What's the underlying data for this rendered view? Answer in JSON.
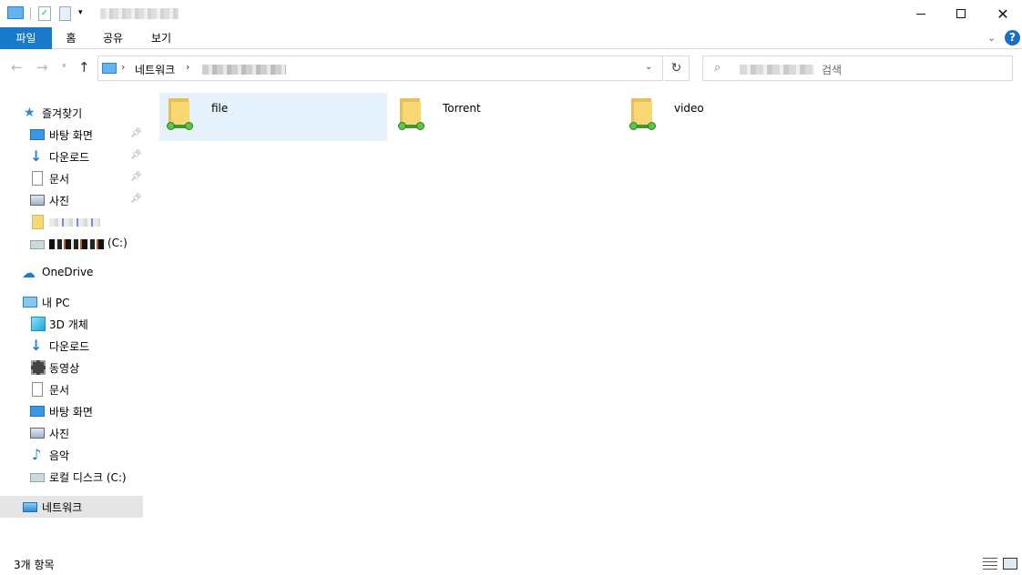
{
  "ribbon": {
    "tabs": [
      "파일",
      "홈",
      "공유",
      "보기"
    ],
    "help": "?"
  },
  "window_controls": {
    "close": "✕"
  },
  "nav": {
    "back": "←",
    "forward": "→",
    "recent": "▾",
    "up": "↑",
    "refresh": "↻",
    "dropdown": "⌄"
  },
  "address": {
    "separator": "›",
    "segments": [
      "네트워크"
    ]
  },
  "search": {
    "placeholder": "검색",
    "icon": "⌕"
  },
  "sidebar": {
    "quick_access": {
      "label": "즐겨찾기",
      "items": [
        {
          "label": "바탕 화면",
          "icon": "desktop-icon",
          "pinned": true
        },
        {
          "label": "다운로드",
          "icon": "download-icon",
          "pinned": true
        },
        {
          "label": "문서",
          "icon": "document-icon",
          "pinned": true
        },
        {
          "label": "사진",
          "icon": "pictures-icon",
          "pinned": true
        },
        {
          "label": "",
          "icon": "folder-icon",
          "pinned": false
        },
        {
          "label": "(C:)",
          "icon": "drive-icon",
          "pinned": false
        }
      ]
    },
    "onedrive": {
      "label": "OneDrive"
    },
    "this_pc": {
      "label": "내 PC",
      "items": [
        {
          "label": "3D 개체",
          "icon": "3d-objects-icon"
        },
        {
          "label": "다운로드",
          "icon": "download-icon"
        },
        {
          "label": "동영상",
          "icon": "videos-icon"
        },
        {
          "label": "문서",
          "icon": "document-icon"
        },
        {
          "label": "바탕 화면",
          "icon": "desktop-icon"
        },
        {
          "label": "사진",
          "icon": "pictures-icon"
        },
        {
          "label": "음악",
          "icon": "music-icon"
        },
        {
          "label": "로컬 디스크 (C:)",
          "icon": "drive-icon"
        }
      ]
    },
    "network": {
      "label": "네트워크",
      "selected": true
    }
  },
  "content": {
    "items": [
      {
        "name": "file",
        "icon": "network-folder-icon",
        "selected": true
      },
      {
        "name": "Torrent",
        "icon": "network-folder-icon",
        "selected": false
      },
      {
        "name": "video",
        "icon": "network-folder-icon",
        "selected": false
      }
    ]
  },
  "status": {
    "text": "3개 항목"
  },
  "colors": {
    "accent": "#1979ca",
    "selection": "#e5f1fb",
    "sidebar_selected": "#e5e5e5"
  }
}
